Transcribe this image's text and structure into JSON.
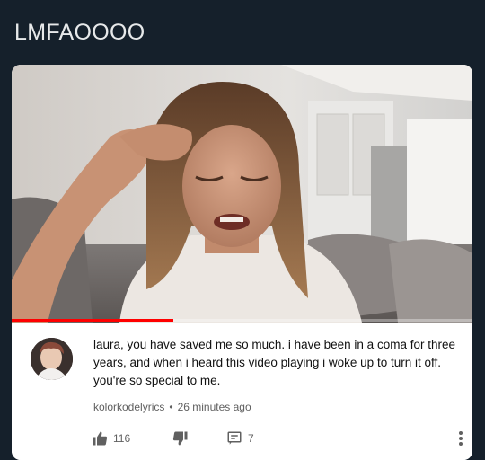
{
  "post": {
    "caption": "LMFAOOOO"
  },
  "video": {
    "progress": 0.35,
    "accent_color": "#ff0000"
  },
  "comment": {
    "text": "laura, you have saved me so much. i have been in a coma for three years, and when i heard this video playing i woke up to turn it off. you're so special to me.",
    "username": "kolorkodelyrics",
    "separator": "•",
    "time": "26 minutes ago",
    "likes": "116",
    "replies": "7"
  },
  "icons": {
    "like": "thumbs-up-icon",
    "dislike": "thumbs-down-icon",
    "reply": "reply-icon",
    "more": "more-vertical-icon"
  }
}
